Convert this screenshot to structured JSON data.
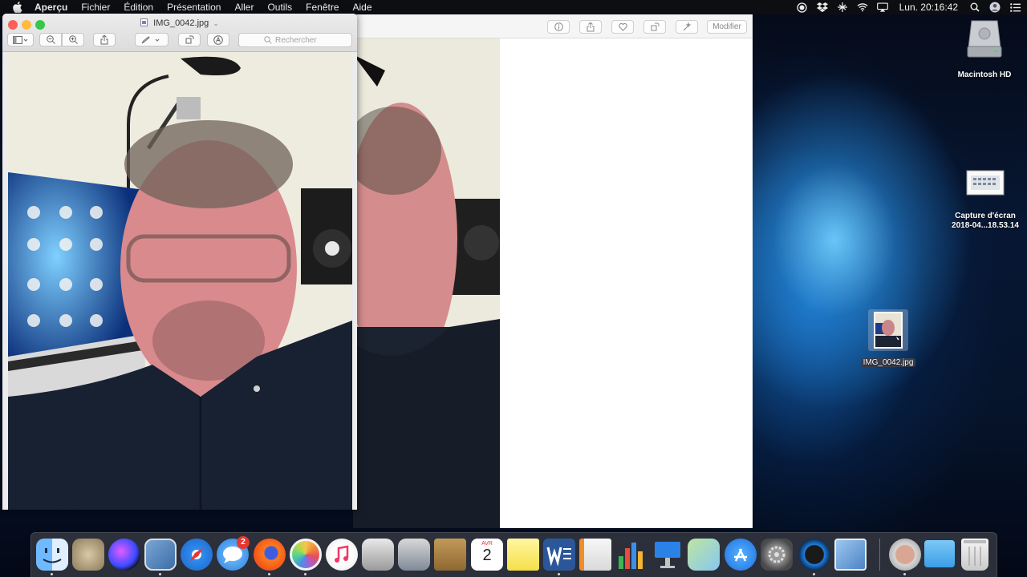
{
  "menubar": {
    "app_name": "Aperçu",
    "items": [
      "Fichier",
      "Édition",
      "Présentation",
      "Aller",
      "Outils",
      "Fenêtre",
      "Aide"
    ],
    "clock": "Lun. 20:16:42"
  },
  "desktop": {
    "icons": [
      {
        "label": "Macintosh HD"
      },
      {
        "label_line1": "Capture d'écran",
        "label_line2": "2018-04...18.53.14"
      },
      {
        "label": "IMG_0042.jpg"
      }
    ]
  },
  "preview_window": {
    "title": "IMG_0042.jpg",
    "search_placeholder": "Rechercher"
  },
  "photos_window": {
    "edit_label": "Modifier"
  },
  "dock": {
    "messages_badge": "2",
    "calendar_month": "AVR",
    "calendar_day": "2",
    "apps": [
      "Finder",
      "Automator",
      "Siri",
      "Aperçu",
      "Safari",
      "Messages",
      "Firefox",
      "Photos",
      "iTunes",
      "Utilitaire",
      "Xcode",
      "Notes",
      "Calendrier",
      "Notes post-it",
      "Word",
      "Pages",
      "Numbers",
      "Keynote",
      "Plans",
      "App Store",
      "Préférences Système",
      "Disque",
      "Aperçu images",
      "Photo Booth",
      "Dossier",
      "Corbeille"
    ]
  },
  "colors": {
    "menubar_bg": "#0d0e12",
    "traffic_red": "#fc605b",
    "traffic_yellow": "#fdbc40",
    "traffic_green": "#34c84a",
    "badge_red": "#e8362e"
  }
}
